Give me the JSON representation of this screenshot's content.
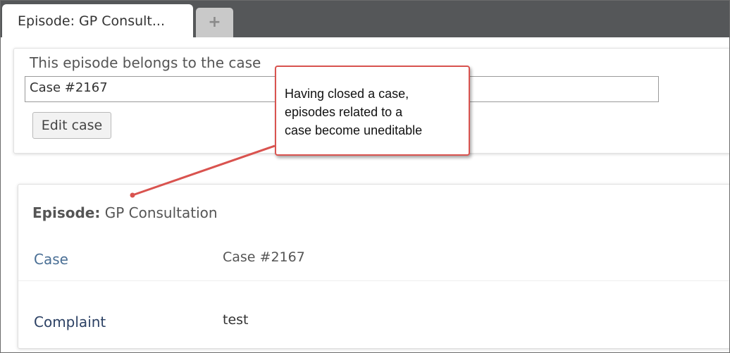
{
  "tabs": {
    "active_label": "Episode: GP Consult...",
    "add_glyph": "+"
  },
  "case_panel": {
    "label": "This episode belongs to the case",
    "case_value": "Case #2167",
    "edit_button_label": "Edit case"
  },
  "episode": {
    "heading_prefix": "Episode:",
    "heading_name": "GP Consultation",
    "fields": [
      {
        "label": "Case",
        "value": "Case #2167"
      },
      {
        "label": "Complaint",
        "value": "test"
      }
    ]
  },
  "callout": {
    "lines": [
      "Having closed a case,",
      "episodes related to a",
      "case become uneditable"
    ],
    "border_color": "#d9534f"
  },
  "colors": {
    "tabstrip": "#555759",
    "link_label": "#4a6f95",
    "dark_label": "#2c4164"
  }
}
